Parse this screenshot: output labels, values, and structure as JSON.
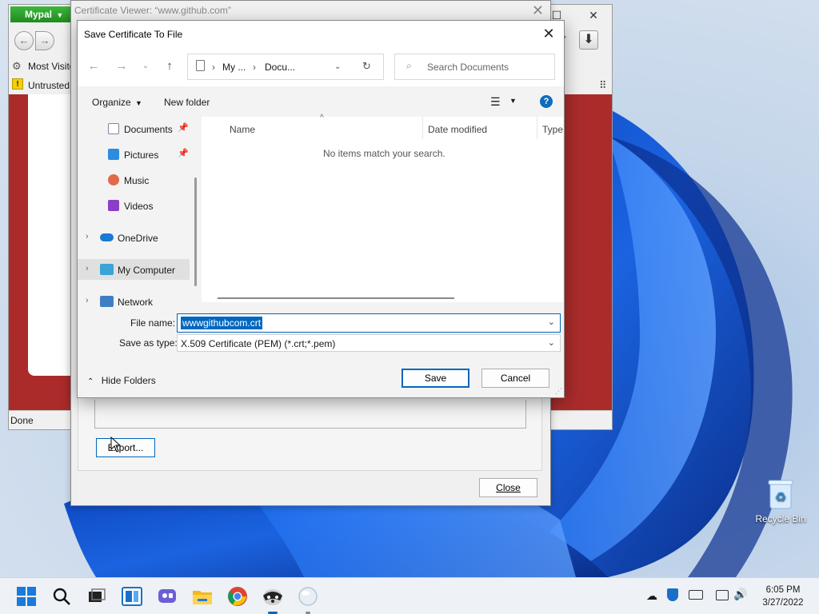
{
  "desktop": {
    "recycle_bin_label": "Recycle Bin"
  },
  "browser": {
    "app_menu_label": "Mypal",
    "bookmark_label": "Most Visite",
    "notification_label": "Untrusted",
    "status_text": "Done",
    "window_buttons": [
      "–",
      "☐",
      "✕"
    ]
  },
  "cert_viewer": {
    "title": "Certificate Viewer: “www.github.com”",
    "export_label": "Export...",
    "close_label": "Close"
  },
  "save_dialog": {
    "title": "Save Certificate To File",
    "breadcrumb": [
      "My ...",
      "Docu..."
    ],
    "search_placeholder": "Search Documents",
    "organize_label": "Organize",
    "new_folder_label": "New folder",
    "nav_items": [
      {
        "label": "Documents",
        "icon": "documents-icon",
        "pinned": true
      },
      {
        "label": "Pictures",
        "icon": "pictures-icon",
        "pinned": true
      },
      {
        "label": "Music",
        "icon": "music-icon",
        "pinned": false
      },
      {
        "label": "Videos",
        "icon": "videos-icon",
        "pinned": false
      },
      {
        "label": "OneDrive",
        "icon": "onedrive-icon",
        "pinned": false
      },
      {
        "label": "My Computer",
        "icon": "computer-icon",
        "pinned": false
      },
      {
        "label": "Network",
        "icon": "network-icon",
        "pinned": false
      }
    ],
    "columns": [
      "Name",
      "Date modified",
      "Type"
    ],
    "empty_message": "No items match your search.",
    "file_name_label": "File name:",
    "file_name_value": "wwwgithubcom.crt",
    "save_type_label": "Save as type:",
    "save_type_value": "X.509 Certificate (PEM) (*.crt;*.pem)",
    "hide_folders_label": "Hide Folders",
    "save_label": "Save",
    "cancel_label": "Cancel"
  },
  "taskbar": {
    "apps": [
      "start-icon",
      "search-icon",
      "task-view-icon",
      "widgets-icon",
      "chat-icon",
      "file-explorer-icon",
      "chrome-icon",
      "mypal-icon",
      "app-icon"
    ],
    "time": "6:05 PM",
    "date": "3/27/2022"
  },
  "colors": {
    "accent": "#0067c0",
    "page_background": "#ab2b2b",
    "mypal_green": "#2ea12e"
  }
}
